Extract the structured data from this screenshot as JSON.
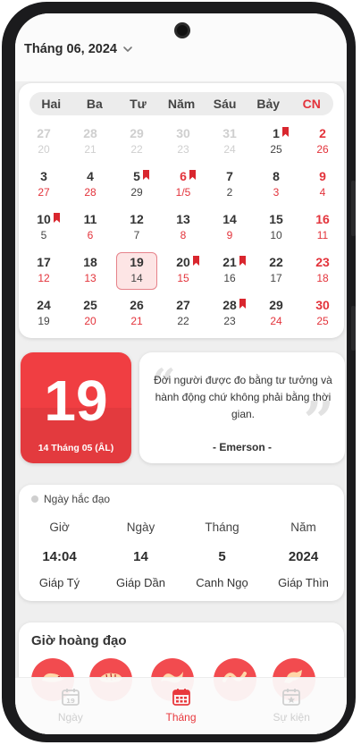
{
  "header": {
    "month_label": "Tháng 06, 2024"
  },
  "calendar": {
    "weekdays": [
      "Hai",
      "Ba",
      "Tư",
      "Năm",
      "Sáu",
      "Bảy",
      "CN"
    ],
    "rows": [
      [
        {
          "solar": "27",
          "lunar": "20",
          "muted": true
        },
        {
          "solar": "28",
          "lunar": "21",
          "muted": true
        },
        {
          "solar": "29",
          "lunar": "22",
          "muted": true
        },
        {
          "solar": "30",
          "lunar": "23",
          "muted": true
        },
        {
          "solar": "31",
          "lunar": "24",
          "muted": true
        },
        {
          "solar": "1",
          "lunar": "25",
          "flag": true
        },
        {
          "solar": "2",
          "lunar": "26"
        }
      ],
      [
        {
          "solar": "3",
          "lunar": "27",
          "lunar_red": true
        },
        {
          "solar": "4",
          "lunar": "28",
          "lunar_red": true
        },
        {
          "solar": "5",
          "lunar": "29",
          "flag": true
        },
        {
          "solar": "6",
          "lunar": "1/5",
          "flag": true,
          "red": true
        },
        {
          "solar": "7",
          "lunar": "2"
        },
        {
          "solar": "8",
          "lunar": "3",
          "lunar_red": true
        },
        {
          "solar": "9",
          "lunar": "4"
        }
      ],
      [
        {
          "solar": "10",
          "lunar": "5",
          "flag": true
        },
        {
          "solar": "11",
          "lunar": "6",
          "lunar_red": true
        },
        {
          "solar": "12",
          "lunar": "7"
        },
        {
          "solar": "13",
          "lunar": "8",
          "lunar_red": true
        },
        {
          "solar": "14",
          "lunar": "9",
          "lunar_red": true
        },
        {
          "solar": "15",
          "lunar": "10"
        },
        {
          "solar": "16",
          "lunar": "11"
        }
      ],
      [
        {
          "solar": "17",
          "lunar": "12",
          "lunar_red": true
        },
        {
          "solar": "18",
          "lunar": "13",
          "lunar_red": true
        },
        {
          "solar": "19",
          "lunar": "14",
          "today": true
        },
        {
          "solar": "20",
          "lunar": "15",
          "flag": true,
          "lunar_red": true
        },
        {
          "solar": "21",
          "lunar": "16",
          "flag": true
        },
        {
          "solar": "22",
          "lunar": "17"
        },
        {
          "solar": "23",
          "lunar": "18"
        }
      ],
      [
        {
          "solar": "24",
          "lunar": "19"
        },
        {
          "solar": "25",
          "lunar": "20",
          "lunar_red": true
        },
        {
          "solar": "26",
          "lunar": "21",
          "lunar_red": true
        },
        {
          "solar": "27",
          "lunar": "22"
        },
        {
          "solar": "28",
          "lunar": "23",
          "flag": true
        },
        {
          "solar": "29",
          "lunar": "24",
          "lunar_red": true
        },
        {
          "solar": "30",
          "lunar": "25"
        }
      ]
    ]
  },
  "today": {
    "day": "19",
    "lunar_label": "14 Tháng 05 (ÂL)"
  },
  "quote": {
    "text": "Đời người được đo bằng tư tưởng và hành động chứ không phải bằng thời gian.",
    "author": "- Emerson -"
  },
  "day_info": {
    "status": "Ngày hắc đạo",
    "columns": [
      {
        "label": "Giờ",
        "value": "14:04",
        "can_chi": "Giáp Tý"
      },
      {
        "label": "Ngày",
        "value": "14",
        "can_chi": "Giáp Dần"
      },
      {
        "label": "Tháng",
        "value": "5",
        "can_chi": "Canh Ngọ"
      },
      {
        "label": "Năm",
        "value": "2024",
        "can_chi": "Giáp Thìn"
      }
    ]
  },
  "gio_hoang_dao": {
    "title": "Giờ hoàng đạo",
    "icons": [
      "rat-icon",
      "tiger-icon",
      "dragon-icon",
      "snake-icon",
      "horse-icon"
    ]
  },
  "tabs": [
    {
      "label": "Ngày",
      "icon": "calendar-day-icon",
      "active": false
    },
    {
      "label": "Tháng",
      "icon": "calendar-month-icon",
      "active": true
    },
    {
      "label": "Sự kiện",
      "icon": "calendar-event-icon",
      "active": false
    }
  ],
  "colors": {
    "accent": "#e8383d",
    "flag": "#d9262e",
    "today_bg": "#fde5e5",
    "big_date_bg": "#f03e42"
  }
}
